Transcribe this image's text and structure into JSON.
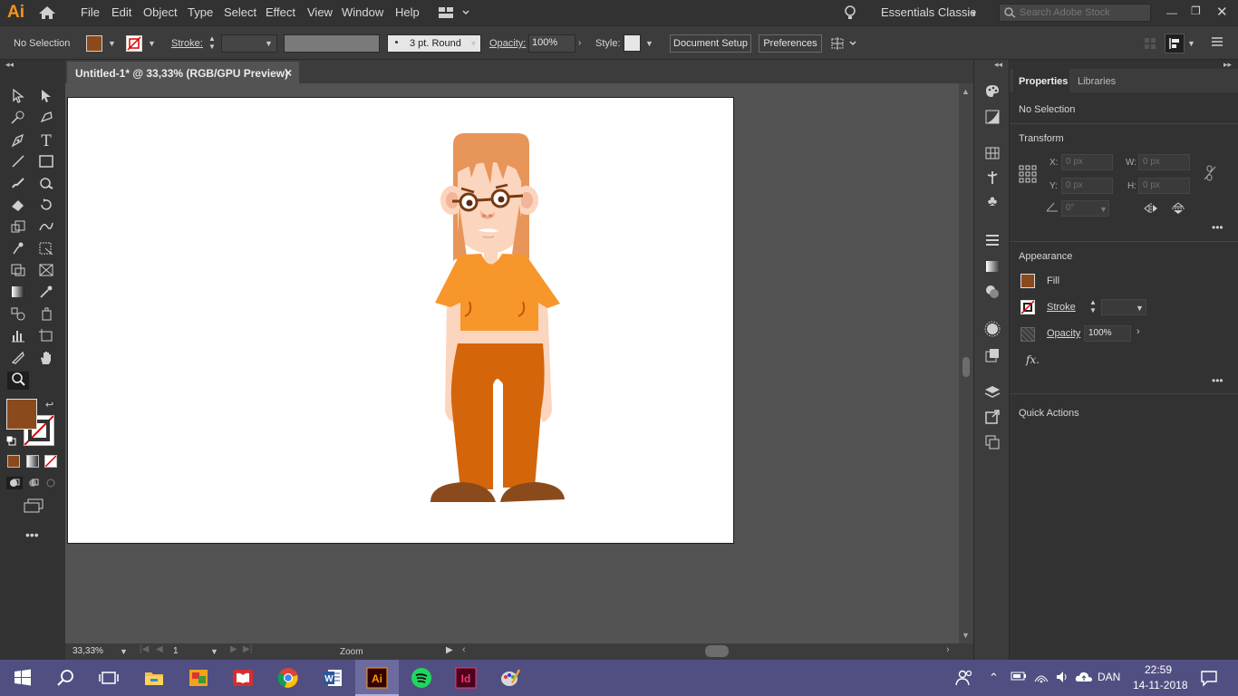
{
  "app": {
    "logo": "Ai"
  },
  "menu": [
    "File",
    "Edit",
    "Object",
    "Type",
    "Select",
    "Effect",
    "View",
    "Window",
    "Help"
  ],
  "workspace": "Essentials Classic",
  "search": {
    "placeholder": "Search Adobe Stock"
  },
  "control_bar": {
    "selection": "No Selection",
    "stroke_label": "Stroke:",
    "brush": "3 pt. Round",
    "opacity_label": "Opacity:",
    "opacity_value": "100%",
    "style_label": "Style:",
    "document_setup": "Document Setup",
    "preferences": "Preferences"
  },
  "document_tab": {
    "title": "Untitled-1* @ 33,33% (RGB/GPU Preview)",
    "close": "×"
  },
  "status_bar": {
    "zoom": "33,33%",
    "artboard": "1",
    "tool": "Zoom"
  },
  "properties_panel": {
    "tabs": [
      "Properties",
      "Libraries"
    ],
    "selection": "No Selection",
    "transform": {
      "title": "Transform",
      "x_label": "X:",
      "x_placeholder": "0 px",
      "y_label": "Y:",
      "y_placeholder": "0 px",
      "w_label": "W:",
      "w_placeholder": "0 px",
      "h_label": "H:",
      "h_placeholder": "0 px",
      "angle_placeholder": "0°"
    },
    "appearance": {
      "title": "Appearance",
      "fill_label": "Fill",
      "stroke_label": "Stroke",
      "opacity_label": "Opacity",
      "opacity_value": "100%",
      "fx_label": "fx."
    },
    "quick_actions": "Quick Actions"
  },
  "colors": {
    "fill": "#8b4a1c",
    "accent": "#f7931e",
    "shirt": "#f7962b",
    "pants": "#d4650a",
    "skin": "#fbd5bd",
    "hair": "#e8955a",
    "shoes": "#8b4a1c"
  },
  "taskbar": {
    "language": "DAN",
    "time": "22:59",
    "date": "14-11-2018"
  }
}
